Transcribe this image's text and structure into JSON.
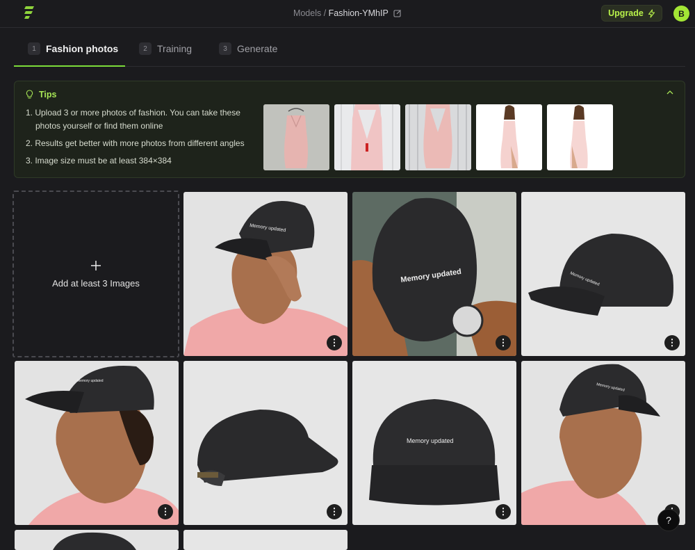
{
  "header": {
    "breadcrumb_parent": "Models",
    "breadcrumb_separator": " / ",
    "breadcrumb_current": "Fashion-YMhIP",
    "upgrade_label": "Upgrade",
    "avatar_initial": "B"
  },
  "tabs": [
    {
      "num": "1",
      "label": "Fashion photos",
      "active": true
    },
    {
      "num": "2",
      "label": "Training",
      "active": false
    },
    {
      "num": "3",
      "label": "Generate",
      "active": false
    }
  ],
  "tips": {
    "title": "Tips",
    "items": [
      "1. Upload 3 or more photos of fashion. You can take these photos yourself or find them online",
      "2. Results get better with more photos from different angles",
      "3. Image size must be at least 384×384"
    ],
    "thumbnails": [
      "pink-dress-hanger",
      "pink-dress-wood-1",
      "pink-dress-wood-2",
      "pink-dress-model-1",
      "pink-dress-model-2"
    ]
  },
  "upload": {
    "add_label": "Add at least 3 Images",
    "images": [
      {
        "name": "man-pink-shirt-cap-front",
        "cap_text": "Memory updated"
      },
      {
        "name": "cap-selfie-under-brim",
        "cap_text": "Memory updated"
      },
      {
        "name": "cap-side-view",
        "cap_text": "Memory updated"
      },
      {
        "name": "man-cap-profile-left",
        "cap_text": "Memory updated"
      },
      {
        "name": "cap-back-view",
        "cap_text": ""
      },
      {
        "name": "cap-front-view",
        "cap_text": "Memory updated"
      },
      {
        "name": "man-cap-looking-right",
        "cap_text": "Memory updated"
      }
    ]
  },
  "help_label": "?",
  "colors": {
    "accent": "#a3e635",
    "background": "#1b1b1e",
    "tips_bg": "#1e231b"
  }
}
